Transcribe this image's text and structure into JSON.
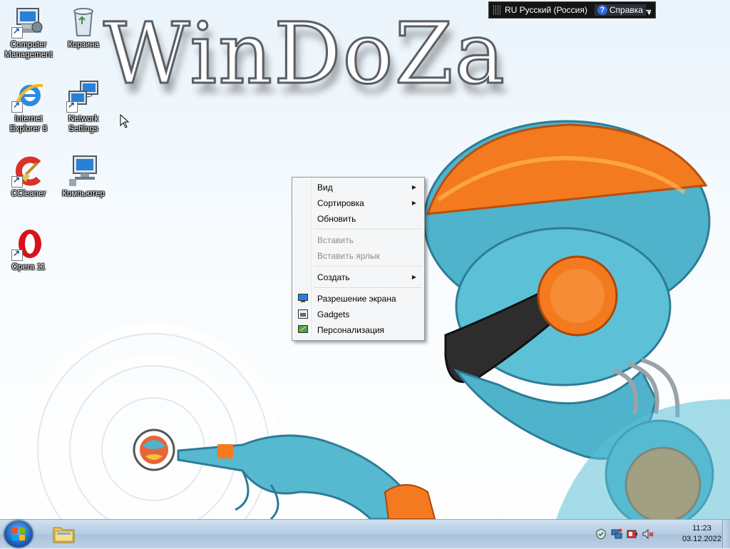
{
  "desktop": {
    "title_text": "WinDoZa",
    "icons": [
      {
        "label": "Computer Management",
        "icon": "computer-management-icon"
      },
      {
        "label": "Корзина",
        "icon": "recycle-bin-icon"
      },
      {
        "label": "Internet Explorer 8",
        "icon": "internet-explorer-icon"
      },
      {
        "label": "Network Settings",
        "icon": "network-settings-icon"
      },
      {
        "label": "CCleaner",
        "icon": "ccleaner-icon"
      },
      {
        "label": "Компьютер",
        "icon": "computer-icon"
      },
      {
        "label": "Opera 11",
        "icon": "opera-icon"
      }
    ]
  },
  "language_bar": {
    "language": "RU Русский (Россия)",
    "help": "Справка",
    "options_icon": "chevron-down-icon"
  },
  "context_menu": {
    "items": [
      {
        "label": "Вид",
        "submenu": true,
        "enabled": true
      },
      {
        "label": "Сортировка",
        "submenu": true,
        "enabled": true
      },
      {
        "label": "Обновить",
        "submenu": false,
        "enabled": true
      },
      {
        "label": "Вставить",
        "submenu": false,
        "enabled": false
      },
      {
        "label": "Вставить ярлык",
        "submenu": false,
        "enabled": false
      },
      {
        "label": "Создать",
        "submenu": true,
        "enabled": true
      },
      {
        "label": "Разрешение экрана",
        "submenu": false,
        "enabled": true,
        "icon": "screen-resolution-icon"
      },
      {
        "label": "Gadgets",
        "submenu": false,
        "enabled": true,
        "icon": "gadgets-icon"
      },
      {
        "label": "Персонализация",
        "submenu": false,
        "enabled": true,
        "icon": "personalization-icon"
      }
    ]
  },
  "taskbar": {
    "start_icon": "windows-logo-icon",
    "pinned": [
      {
        "icon": "folder-icon"
      }
    ],
    "tray_icons": [
      "action-center-icon",
      "network-icon",
      "power-icon",
      "volume-muted-icon"
    ],
    "clock": {
      "time": "11:23",
      "date": "03.12.2022"
    }
  },
  "colors": {
    "taskbar": "#b8cee4",
    "accent": "#2f6bd8",
    "robot_orange": "#f47a1f",
    "robot_blue": "#4fb3cc"
  }
}
